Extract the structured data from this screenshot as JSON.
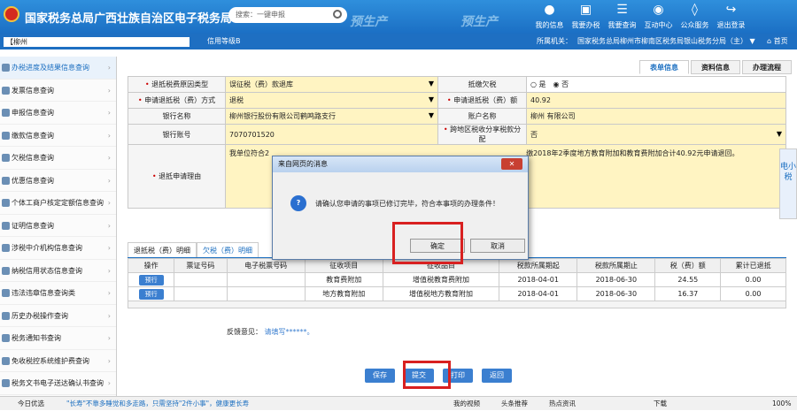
{
  "header": {
    "title": "国家税务总局广西壮族自治区电子税务局",
    "watermark": "预生产",
    "search_placeholder": "搜索：一键申报"
  },
  "topnav": [
    {
      "label": "我的信息",
      "icon": "user-icon"
    },
    {
      "label": "我要办税",
      "icon": "monitor-icon"
    },
    {
      "label": "我要查询",
      "icon": "search-doc-icon"
    },
    {
      "label": "互动中心",
      "icon": "chat-icon"
    },
    {
      "label": "公众服务",
      "icon": "layers-icon"
    },
    {
      "label": "退出登录",
      "icon": "logout-icon"
    }
  ],
  "subbar": {
    "user_prefix": "【柳州",
    "credit": "信用等级B",
    "org_label": "所属机关：",
    "org": "国家税务总局柳州市柳南区税务局银山税务分局（主）",
    "home": "首页"
  },
  "sidebar": [
    "办税进度及结果信息查询",
    "发票信息查询",
    "申报信息查询",
    "缴款信息查询",
    "欠税信息查询",
    "优惠信息查询",
    "个体工商户核定定额信息查询",
    "证明信息查询",
    "涉税中介机构信息查询",
    "纳税信用状态信息查询",
    "违法违章信息查询类",
    "历史办税操作查询",
    "税务通知书查询",
    "免收税控系统维护费查询",
    "税务文书电子送达确认书查询"
  ],
  "tabs": [
    "表单信息",
    "资料信息",
    "办理流程"
  ],
  "form": {
    "reason_label": "退抵税费原因类型",
    "reason_value": "误征税（费）款退库",
    "offset_label": "抵缴欠税",
    "yes": "是",
    "no": "否",
    "method_label": "申请退抵税（费）方式",
    "method_value": "退税",
    "amount_label": "申请退抵税（费）额",
    "amount_value": "40.92",
    "bank_label": "银行名称",
    "bank_value": "柳州银行股份有限公司鹤鸣路支行",
    "acct_name_label": "账户名称",
    "acct_name_value": "柳州                有限公司",
    "acct_no_label": "银行账号",
    "acct_no_value": "7070701520",
    "cross_label": "跨地区税收分享税款分配",
    "cross_value": "否",
    "apply_label": "退抵申请理由",
    "apply_value": "我单位符合2",
    "apply_tail": "缴2018年2季度地方教育附加和教育费附加合计40.92元申请退回。"
  },
  "subtabs": [
    "退抵税（费）明细",
    "欠税（费）明细"
  ],
  "table": {
    "headers": [
      "操作",
      "票证号码",
      "电子税票号码",
      "征收项目",
      "征收品目",
      "税款所属期起",
      "税款所属期止",
      "税（费）额",
      "累计已退抵"
    ],
    "rows": [
      {
        "op": "预行",
        "item": "教育费附加",
        "sub": "增值税教育费附加",
        "start": "2018-04-01",
        "end": "2018-06-30",
        "amt": "24.55",
        "cum": "0.00"
      },
      {
        "op": "预行",
        "item": "地方教育附加",
        "sub": "增值税地方教育附加",
        "start": "2018-04-01",
        "end": "2018-06-30",
        "amt": "16.37",
        "cum": "0.00"
      }
    ]
  },
  "feedback": {
    "label": "反馈意见：",
    "value": "请填写******。"
  },
  "actions": [
    "保存",
    "提交",
    "打印",
    "返回"
  ],
  "dialog": {
    "title": "来自网页的消息",
    "message": "请确认您申请的事项已修订完毕，符合本事项的办理条件！",
    "ok": "确定",
    "cancel": "取消"
  },
  "sidetab": "电小税",
  "statusbar": {
    "left": "今日优选",
    "news": "\"长寿\"不靠多睡觉和多走路，只需坚持\"2件小事\"，健康更长寿",
    "items": [
      "我的视频",
      "头条推荐",
      "热点资讯",
      "下载"
    ],
    "zoom": "100%"
  }
}
